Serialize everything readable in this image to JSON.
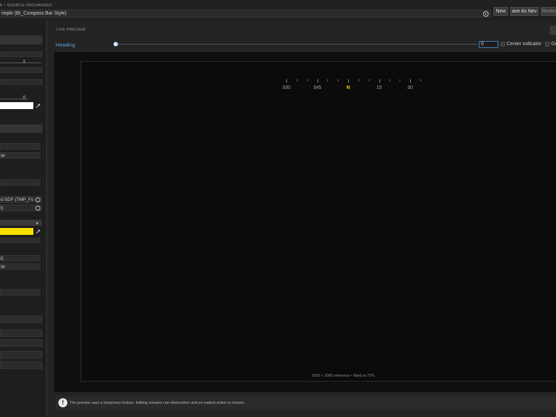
{
  "header": {
    "breadcrumb": "E  •  SOURCE UNCHANGED",
    "asset_name": "imple (BI_Compass Bar Style)",
    "buttons": {
      "new": "New",
      "save_as": "ave As Nev",
      "revert": "Revert"
    }
  },
  "inspector": {
    "field_value_1": "1",
    "field_value_2": "0",
    "dropdown_w": "W",
    "font_asset": "d SDF (TMP_Fo",
    "material_suffix": "l)",
    "label_e": "E",
    "label_w": "W",
    "colors": {
      "primary": "#ffffff",
      "accent": "#f5e000"
    }
  },
  "preview": {
    "section_title": "LIVE PREVIEW",
    "heading_label": "Heading",
    "heading_value": "0",
    "heading_fraction": 0.0,
    "center_indicator_label": "Center Indicator",
    "grid_label": "Gr",
    "compass_labels": [
      "330",
      "345",
      "N",
      "15",
      "30"
    ],
    "footnote": "1920 × 1080 reference  •  fitted at 72%"
  },
  "notice": {
    "icon": "exclamation-icon",
    "text": "The preview uses a temporary texture. Editing remains non-destructive until an explicit action is chosen."
  }
}
